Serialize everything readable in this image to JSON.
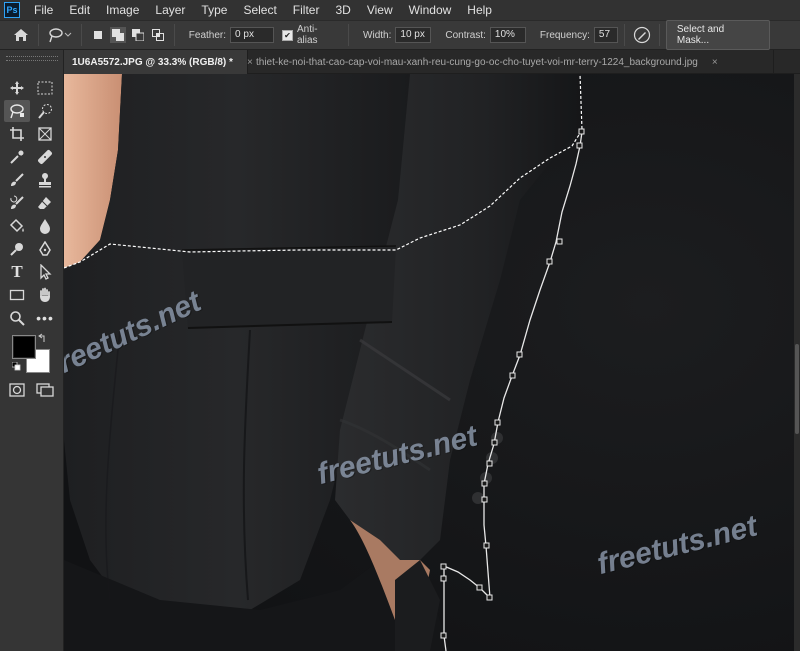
{
  "app": {
    "logo": "Ps"
  },
  "menu": [
    "File",
    "Edit",
    "Image",
    "Layer",
    "Type",
    "Select",
    "Filter",
    "3D",
    "View",
    "Window",
    "Help"
  ],
  "options": {
    "feather_label": "Feather:",
    "feather_value": "0 px",
    "antialias_label": "Anti-alias",
    "antialias_checked": true,
    "width_label": "Width:",
    "width_value": "10 px",
    "contrast_label": "Contrast:",
    "contrast_value": "10%",
    "frequency_label": "Frequency:",
    "frequency_value": "57",
    "select_mask_label": "Select and Mask..."
  },
  "tabs": [
    {
      "label": "1U6A5572.JPG @ 33.3% (RGB/8) *",
      "close": "×",
      "active": true
    },
    {
      "label": "thiet-ke-noi-that-cao-cap-voi-mau-xanh-reu-cung-go-oc-cho-tuyet-voi-mr-terry-1224_background.jpg",
      "close": "×",
      "active": false
    }
  ],
  "tools": [
    "move-icon",
    "marquee-icon",
    "magnetic-lasso-icon",
    "quick-selection-icon",
    "crop-icon",
    "frame-icon",
    "eyedropper-icon",
    "healing-brush-icon",
    "brush-icon",
    "clone-stamp-icon",
    "history-brush-icon",
    "eraser-icon",
    "paint-bucket-icon",
    "blur-icon",
    "dodge-icon",
    "pen-icon",
    "type-icon",
    "path-selection-icon",
    "rectangle-icon",
    "hand-icon",
    "zoom-icon",
    "more-tools-icon",
    "foreground-color-icon",
    "background-color-icon",
    "quick-mask-icon",
    "screen-mode-icon"
  ],
  "colors": {
    "foreground": "#000000",
    "background": "#ffffff",
    "accent": "#31a8ff"
  },
  "canvas": {
    "watermarks": [
      "freetuts.net",
      "freetuts.net",
      "freetuts.net"
    ]
  }
}
